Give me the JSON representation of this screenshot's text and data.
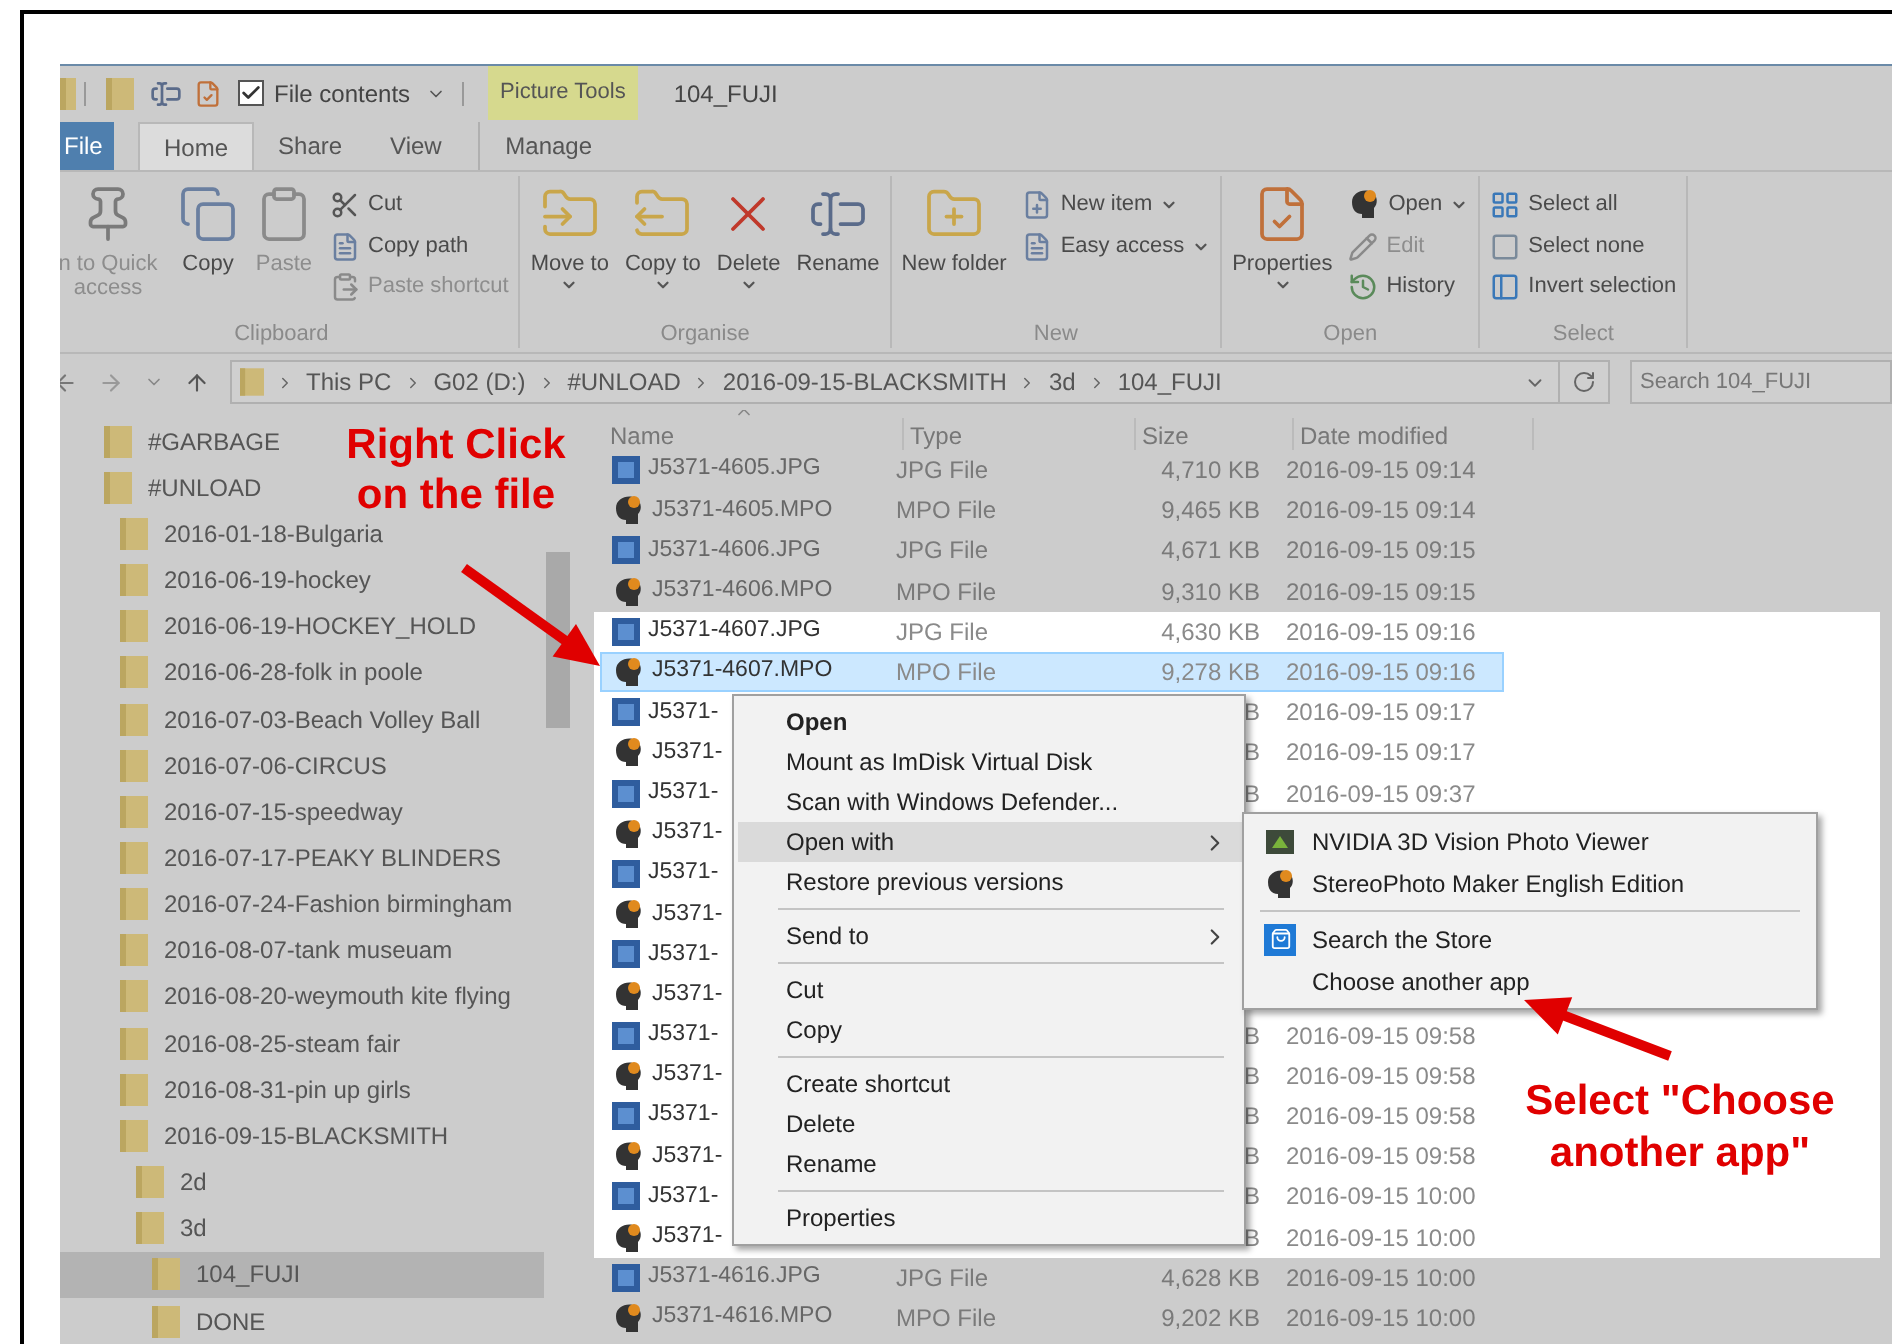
{
  "title_bar": {
    "file_contents": {
      "label": "File contents",
      "checked": true
    },
    "context_tab": "Picture Tools",
    "title": "104_FUJI"
  },
  "ribbon_tabs": [
    {
      "label": "File",
      "kind": "file",
      "selected": false
    },
    {
      "label": "Home",
      "kind": "tab",
      "selected": true
    },
    {
      "label": "Share",
      "kind": "tab",
      "selected": false
    },
    {
      "label": "View",
      "kind": "tab",
      "selected": false
    },
    {
      "label": "Manage",
      "kind": "context",
      "selected": false
    }
  ],
  "ribbon_groups": [
    {
      "name": "Clipboard",
      "items": [
        {
          "kind": "large",
          "label": "n to Quick access",
          "disabled": true,
          "dropdown": false
        },
        {
          "kind": "large",
          "label": "Copy",
          "disabled": false,
          "dropdown": false
        },
        {
          "kind": "large",
          "label": "Paste",
          "disabled": true,
          "dropdown": false
        },
        {
          "kind": "small",
          "label": "Cut",
          "disabled": false,
          "dropdown": false
        },
        {
          "kind": "small",
          "label": "Copy path",
          "disabled": false,
          "dropdown": false
        },
        {
          "kind": "small",
          "label": "Paste shortcut",
          "disabled": true,
          "dropdown": false
        }
      ]
    },
    {
      "name": "Organise",
      "items": [
        {
          "kind": "large",
          "label": "Move to",
          "disabled": false,
          "dropdown": true
        },
        {
          "kind": "large",
          "label": "Copy to",
          "disabled": false,
          "dropdown": true
        },
        {
          "kind": "large",
          "label": "Delete",
          "disabled": false,
          "dropdown": true
        },
        {
          "kind": "large",
          "label": "Rename",
          "disabled": false,
          "dropdown": false
        }
      ]
    },
    {
      "name": "New",
      "items": [
        {
          "kind": "large",
          "label": "New folder",
          "disabled": false,
          "dropdown": false
        },
        {
          "kind": "small",
          "label": "New item",
          "disabled": false,
          "dropdown": true
        },
        {
          "kind": "small",
          "label": "Easy access",
          "disabled": false,
          "dropdown": true
        }
      ]
    },
    {
      "name": "Open",
      "items": [
        {
          "kind": "large",
          "label": "Properties",
          "disabled": false,
          "dropdown": true
        },
        {
          "kind": "small",
          "label": "Open",
          "disabled": false,
          "dropdown": true
        },
        {
          "kind": "small",
          "label": "Edit",
          "disabled": true,
          "dropdown": false
        },
        {
          "kind": "small",
          "label": "History",
          "disabled": false,
          "dropdown": false
        }
      ]
    },
    {
      "name": "Select",
      "items": [
        {
          "kind": "small",
          "label": "Select all",
          "disabled": false,
          "dropdown": false
        },
        {
          "kind": "small",
          "label": "Select none",
          "disabled": false,
          "dropdown": false
        },
        {
          "kind": "small",
          "label": "Invert selection",
          "disabled": false,
          "dropdown": false
        }
      ]
    }
  ],
  "address_bar": {
    "crumbs": [
      "This PC",
      "G02 (D:)",
      "#UNLOAD",
      "2016-09-15-BLACKSMITH",
      "3d",
      "104_FUJI"
    ],
    "search_placeholder": "Search 104_FUJI"
  },
  "tree": [
    {
      "label": "#GARBAGE",
      "selected": false
    },
    {
      "label": "#UNLOAD",
      "selected": false,
      "children": [
        {
          "label": "2016-01-18-Bulgaria",
          "selected": false
        },
        {
          "label": "2016-06-19-hockey",
          "selected": false
        },
        {
          "label": "2016-06-19-HOCKEY_HOLD",
          "selected": false
        },
        {
          "label": "2016-06-28-folk in poole",
          "selected": false
        },
        {
          "label": "2016-07-03-Beach Volley Ball",
          "selected": false
        },
        {
          "label": "2016-07-06-CIRCUS",
          "selected": false
        },
        {
          "label": "2016-07-15-speedway",
          "selected": false
        },
        {
          "label": "2016-07-17-PEAKY BLINDERS",
          "selected": false
        },
        {
          "label": "2016-07-24-Fashion birmingham",
          "selected": false
        },
        {
          "label": "2016-08-07-tank museuam",
          "selected": false
        },
        {
          "label": "2016-08-20-weymouth kite flying",
          "selected": false
        },
        {
          "label": "2016-08-25-steam fair",
          "selected": false
        },
        {
          "label": "2016-08-31-pin up girls",
          "selected": false
        },
        {
          "label": "2016-09-15-BLACKSMITH",
          "selected": false,
          "children": [
            {
              "label": "2d",
              "selected": false
            },
            {
              "label": "3d",
              "selected": false,
              "children": [
                {
                  "label": "104_FUJI",
                  "selected": true
                },
                {
                  "label": "DONE",
                  "selected": false
                }
              ]
            }
          ]
        }
      ]
    }
  ],
  "file_list": {
    "columns": [
      "Name",
      "Type",
      "Size",
      "Date modified"
    ],
    "rows": [
      {
        "kind": "jpg",
        "name": "J5371-4605.JPG",
        "type": "JPG File",
        "size": "4,710 KB",
        "date": "2016-09-15 09:14",
        "selected": false,
        "highlighted": false
      },
      {
        "kind": "mpo",
        "name": "J5371-4605.MPO",
        "type": "MPO File",
        "size": "9,465 KB",
        "date": "2016-09-15 09:14",
        "selected": false,
        "highlighted": false
      },
      {
        "kind": "jpg",
        "name": "J5371-4606.JPG",
        "type": "JPG File",
        "size": "4,671 KB",
        "date": "2016-09-15 09:15",
        "selected": false,
        "highlighted": false
      },
      {
        "kind": "mpo",
        "name": "J5371-4606.MPO",
        "type": "MPO File",
        "size": "9,310 KB",
        "date": "2016-09-15 09:15",
        "selected": false,
        "highlighted": false
      },
      {
        "kind": "jpg",
        "name": "J5371-4607.JPG",
        "type": "JPG File",
        "size": "4,630 KB",
        "date": "2016-09-15 09:16",
        "selected": false,
        "highlighted": true
      },
      {
        "kind": "mpo",
        "name": "J5371-4607.MPO",
        "type": "MPO File",
        "size": "9,278 KB",
        "date": "2016-09-15 09:16",
        "selected": true,
        "highlighted": true
      },
      {
        "kind": "jpg",
        "name": "J5371-",
        "size": "B",
        "date": "2016-09-15 09:17",
        "selected": false,
        "highlighted": true
      },
      {
        "kind": "mpo",
        "name": "J5371-",
        "size": "B",
        "date": "2016-09-15 09:17",
        "selected": false,
        "highlighted": true
      },
      {
        "kind": "jpg",
        "name": "J5371-",
        "size": "B",
        "date": "2016-09-15 09:37",
        "selected": false,
        "highlighted": true
      },
      {
        "kind": "mpo",
        "name": "J5371-",
        "selected": false,
        "highlighted": true
      },
      {
        "kind": "jpg",
        "name": "J5371-",
        "selected": false,
        "highlighted": true
      },
      {
        "kind": "mpo",
        "name": "J5371-",
        "selected": false,
        "highlighted": true
      },
      {
        "kind": "jpg",
        "name": "J5371-",
        "selected": false,
        "highlighted": true
      },
      {
        "kind": "mpo",
        "name": "J5371-",
        "selected": false,
        "highlighted": true
      },
      {
        "kind": "jpg",
        "name": "J5371-",
        "size": "B",
        "date": "2016-09-15 09:58",
        "selected": false,
        "highlighted": true
      },
      {
        "kind": "mpo",
        "name": "J5371-",
        "size": "B",
        "date": "2016-09-15 09:58",
        "selected": false,
        "highlighted": true
      },
      {
        "kind": "jpg",
        "name": "J5371-",
        "size": "B",
        "date": "2016-09-15 09:58",
        "selected": false,
        "highlighted": true
      },
      {
        "kind": "mpo",
        "name": "J5371-",
        "size": "B",
        "date": "2016-09-15 09:58",
        "selected": false,
        "highlighted": true
      },
      {
        "kind": "jpg",
        "name": "J5371-",
        "size": "B",
        "date": "2016-09-15 10:00",
        "selected": false,
        "highlighted": true
      },
      {
        "kind": "mpo",
        "name": "J5371-",
        "size": "B",
        "date": "2016-09-15 10:00",
        "selected": false,
        "highlighted": true
      },
      {
        "kind": "jpg",
        "name": "J5371-4616.JPG",
        "type": "JPG File",
        "size": "4,628 KB",
        "date": "2016-09-15 10:00",
        "selected": false,
        "highlighted": false
      },
      {
        "kind": "mpo",
        "name": "J5371-4616.MPO",
        "type": "MPO File",
        "size": "9,202 KB",
        "date": "2016-09-15 10:00",
        "selected": false,
        "highlighted": false
      }
    ]
  },
  "context_menu": [
    {
      "label": "Open",
      "default": true,
      "submenu": false,
      "divider_before": false,
      "selected": false
    },
    {
      "label": "Mount as ImDisk Virtual Disk",
      "default": false,
      "submenu": false,
      "divider_before": false,
      "selected": false
    },
    {
      "label": "Scan with Windows Defender...",
      "default": false,
      "submenu": false,
      "divider_before": false,
      "selected": false
    },
    {
      "label": "Open with",
      "default": false,
      "submenu": true,
      "divider_before": false,
      "selected": true
    },
    {
      "label": "Restore previous versions",
      "default": false,
      "submenu": false,
      "divider_before": false,
      "selected": false
    },
    {
      "label": "Send to",
      "default": false,
      "submenu": true,
      "divider_before": true,
      "selected": false
    },
    {
      "label": "Cut",
      "default": false,
      "submenu": false,
      "divider_before": true,
      "selected": false
    },
    {
      "label": "Copy",
      "default": false,
      "submenu": false,
      "divider_before": false,
      "selected": false
    },
    {
      "label": "Create shortcut",
      "default": false,
      "submenu": false,
      "divider_before": true,
      "selected": false
    },
    {
      "label": "Delete",
      "default": false,
      "submenu": false,
      "divider_before": false,
      "selected": false
    },
    {
      "label": "Rename",
      "default": false,
      "submenu": false,
      "divider_before": false,
      "selected": false
    },
    {
      "label": "Properties",
      "default": false,
      "submenu": false,
      "divider_before": true,
      "selected": false
    }
  ],
  "open_with_menu": [
    {
      "label": "NVIDIA 3D Vision Photo Viewer",
      "kind": "viewer",
      "divider_before": false
    },
    {
      "label": "StereoPhoto Maker English Edition",
      "kind": "stereo",
      "divider_before": false
    },
    {
      "label": "Search the Store",
      "kind": "store",
      "divider_before": true
    },
    {
      "label": "Choose another app",
      "kind": "plain",
      "divider_before": false
    }
  ],
  "annotations": [
    {
      "text": "Right Click on the file"
    },
    {
      "text": "Select \"Choose another app\""
    }
  ]
}
